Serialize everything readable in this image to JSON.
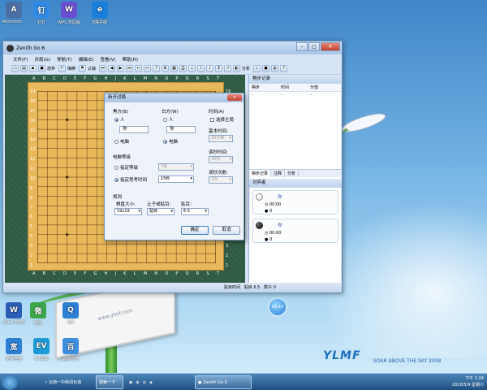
{
  "desktop": {
    "icons_top": [
      {
        "label": "Administr...",
        "color": "#4a6fa5",
        "glyph": "A"
      },
      {
        "label": "钉钉",
        "color": "#2f8ae6",
        "glyph": "钉"
      },
      {
        "label": "WPS 校园版",
        "color": "#6b4fd1",
        "glyph": "W"
      },
      {
        "label": "E路护航",
        "color": "#1a7fd9",
        "glyph": "e"
      }
    ],
    "icons_left": [
      {
        "label": "Word 2003",
        "color": "#2a5fb3",
        "glyph": "W"
      },
      {
        "label": "微信",
        "color": "#3aa84a",
        "glyph": "微"
      },
      {
        "label": "QQ",
        "color": "#2d7fd4",
        "glyph": "Q"
      }
    ],
    "icons_bottom": [
      {
        "label": "宽带连接",
        "color": "#2d7fd4",
        "glyph": "宽"
      },
      {
        "label": "EV录屏",
        "color": "#1c9ad6",
        "glyph": "EV"
      },
      {
        "label": "百度网盘",
        "color": "#3d8fe0",
        "glyph": "百"
      }
    ],
    "billboard_text": "www.ylmf.com",
    "logo_text": "YLMF",
    "slogan": "SOAR ABOVE THE SKY 2008",
    "clock_bubble": "00:14"
  },
  "taskbar": {
    "items": [
      {
        "label": "云南一中新闻长城",
        "active": false
      },
      {
        "label": "搜索一下",
        "active": true
      },
      {
        "label": "Zenith Go 6",
        "active": true
      }
    ],
    "time": "下午 1:24",
    "date": "2020/5/9 星期六"
  },
  "window": {
    "title": "Zenith Go 6",
    "menu": [
      "文件(F)",
      "对局(G)",
      "导航(T)",
      "编辑(E)",
      "查看(V)",
      "帮助(H)"
    ],
    "toolbar_labels": [
      "放弃",
      "悔棋",
      "认输",
      "分析"
    ],
    "board": {
      "columns": [
        "A",
        "B",
        "C",
        "D",
        "E",
        "F",
        "G",
        "H",
        "J",
        "K",
        "L",
        "M",
        "N",
        "O",
        "P",
        "Q",
        "R",
        "S",
        "T"
      ],
      "rows": [
        "19",
        "18",
        "17",
        "16",
        "15",
        "14",
        "13",
        "12",
        "11",
        "10",
        "9",
        "8",
        "7",
        "6",
        "5",
        "4",
        "3",
        "2",
        "1"
      ]
    },
    "side_panel": {
      "header": "棋步记录",
      "columns": [
        "棋步",
        "时间",
        "分值"
      ],
      "rows": [
        [
          "-",
          "-",
          "-"
        ]
      ],
      "tabs": [
        "棋步记录",
        "注释",
        "分析"
      ],
      "players_header": "对弈者",
      "white": {
        "name": "你",
        "time": "00:00",
        "captured": "0"
      },
      "black": {
        "name": "你",
        "time": "00:00",
        "captured": "0"
      }
    },
    "status": {
      "komi_label": "贴目",
      "komi": "6.5",
      "captured_label": "数子",
      "captured": "0",
      "left": "贴目时间"
    }
  },
  "dialog": {
    "title": "新开对局",
    "black_label": "黑方(B)",
    "white_label": "白方(W)",
    "human": "人",
    "computer": "电脑",
    "black_name": "你",
    "white_name": "你",
    "time_label": "时间(A)",
    "time_checkbox": "选择主局",
    "basic_time_label": "基本时间:",
    "basic_time": "30分钟",
    "byoyomi_label": "读秒时间:",
    "byoyomi": "30秒",
    "byoyomi_count_label": "读秒次数:",
    "byoyomi_count": "3次",
    "ai_level_label": "电脑等级",
    "fixed_level": "指定等级",
    "fixed_level_value": "7级",
    "fixed_time": "指定思考时间",
    "fixed_time_value": "15秒",
    "rules_label": "规则",
    "board_size_label": "棋盘大小:",
    "board_size": "19x19",
    "handicap_label": "让子或贴目:",
    "handicap": "贴目",
    "komi_label": "贴目:",
    "komi": "6.5",
    "ok": "确定",
    "cancel": "取消"
  }
}
